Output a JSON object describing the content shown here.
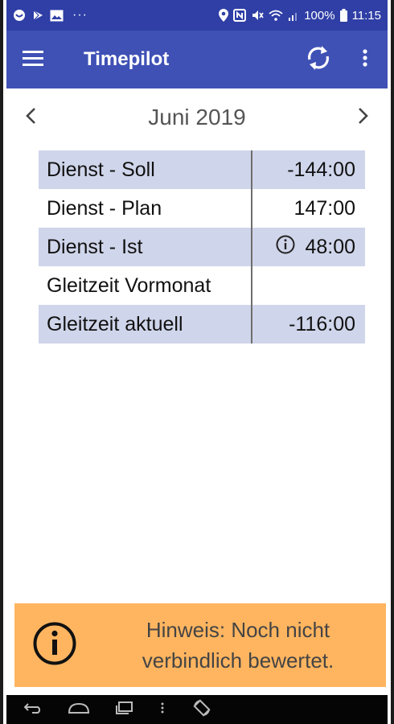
{
  "status_bar": {
    "left_icons": [
      "notification-circle-icon",
      "play-store-icon",
      "image-icon",
      "more-dots-icon"
    ],
    "dots": "···",
    "right_icons": [
      "location-icon",
      "nfc-icon",
      "mute-icon",
      "wifi-icon",
      "signal-icon"
    ],
    "battery": "100%",
    "time": "11:15"
  },
  "app_bar": {
    "title": "Timepilot",
    "icons": [
      "menu-icon",
      "sync-icon",
      "overflow-menu-icon"
    ]
  },
  "month_nav": {
    "label": "Juni 2019",
    "prev_icon": "chevron-left-icon",
    "next_icon": "chevron-right-icon"
  },
  "summary": {
    "rows": [
      {
        "label": "Dienst - Soll",
        "value": "-144:00",
        "info": false
      },
      {
        "label": "Dienst - Plan",
        "value": "147:00",
        "info": false
      },
      {
        "label": "Dienst - Ist",
        "value": "48:00",
        "info": true
      },
      {
        "label": "Gleitzeit Vormonat",
        "value": "",
        "info": false
      },
      {
        "label": "Gleitzeit aktuell",
        "value": "-116:00",
        "info": false
      }
    ]
  },
  "banner": {
    "line1": "Hinweis: Noch nicht",
    "line2": "verbindlich bewertet.",
    "icon": "info-icon",
    "color": "#ffb560"
  },
  "colors": {
    "primary": "#3f51b5",
    "status_bar": "#2f3fa6",
    "row_shade": "#cfd5ea"
  },
  "system_nav": {
    "icons": [
      "back-icon",
      "home-icon",
      "recents-icon",
      "keyboard-dot-icon",
      "rotate-icon"
    ]
  }
}
